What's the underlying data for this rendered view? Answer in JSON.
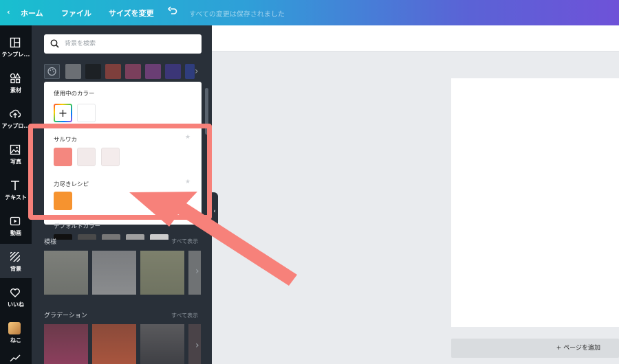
{
  "topbar": {
    "home_label": "ホーム",
    "file_label": "ファイル",
    "resize_label": "サイズを変更",
    "saved_text": "すべての変更は保存されました"
  },
  "rail": {
    "items": [
      {
        "label": "テンプレ...",
        "icon": "template-icon"
      },
      {
        "label": "素材",
        "icon": "shapes-icon"
      },
      {
        "label": "アップロ...",
        "icon": "upload-icon"
      },
      {
        "label": "写真",
        "icon": "photo-icon"
      },
      {
        "label": "テキスト",
        "icon": "text-icon"
      },
      {
        "label": "動画",
        "icon": "video-icon"
      },
      {
        "label": "背景",
        "icon": "background-icon"
      },
      {
        "label": "いいね",
        "icon": "heart-icon"
      },
      {
        "label": "ねこ",
        "icon": "avatar"
      }
    ]
  },
  "search": {
    "placeholder": "背景を検索"
  },
  "swatches": [
    "#6b6f74",
    "#1d2125",
    "#7e3f3c",
    "#7a3f5c",
    "#6a3e74",
    "#3b3677",
    "#2f3d7d"
  ],
  "colors_panel": {
    "in_use_heading": "使用中のカラー",
    "in_use_colors": [
      "#ffffff"
    ],
    "palettes": [
      {
        "name": "サルワカ",
        "colors": [
          "#f4877f",
          "#f2eaea",
          "#f4ecec"
        ]
      },
      {
        "name": "力尽きレシピ",
        "colors": [
          "#f6932f"
        ]
      }
    ],
    "default_heading": "デフォルトカラー",
    "default_colors": [
      "#111111",
      "#4a4a4a",
      "#777777",
      "#a0a0a0",
      "#cccccc"
    ]
  },
  "sections": {
    "patterns_title": "模様",
    "patterns_see_all": "すべて表示",
    "gradients_title": "グラデーション",
    "gradients_see_all": "すべて表示"
  },
  "canvas": {
    "add_page_label": "+ ページを追加"
  },
  "colors": {
    "annotation": "#f7817a",
    "panel_bg": "#293039",
    "rail_bg": "#0e1318"
  }
}
